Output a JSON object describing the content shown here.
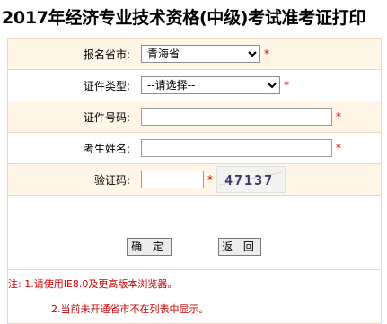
{
  "title": "2017年经济专业技术资格(中级)考试准考证打印",
  "form": {
    "province": {
      "label": "报名省市:",
      "value": "青海省"
    },
    "cert_type": {
      "label": "证件类型:",
      "value": "--请选择--"
    },
    "cert_number": {
      "label": "证件号码:",
      "value": ""
    },
    "name": {
      "label": "考生姓名:",
      "value": ""
    },
    "captcha": {
      "label": "验证码:",
      "value": "",
      "image_text": "47137"
    },
    "required_mark": "*"
  },
  "buttons": {
    "confirm": "确 定",
    "back": "返 回"
  },
  "notes": [
    "注: 1.请使用IE8.0及更高版本浏览器。",
    "2.当前未开通省市不在列表中显示。"
  ],
  "colors": {
    "row_bg": "#fff6e8",
    "border": "#f0d7b8",
    "required": "#cc0000",
    "note_text": "#cc0000"
  }
}
